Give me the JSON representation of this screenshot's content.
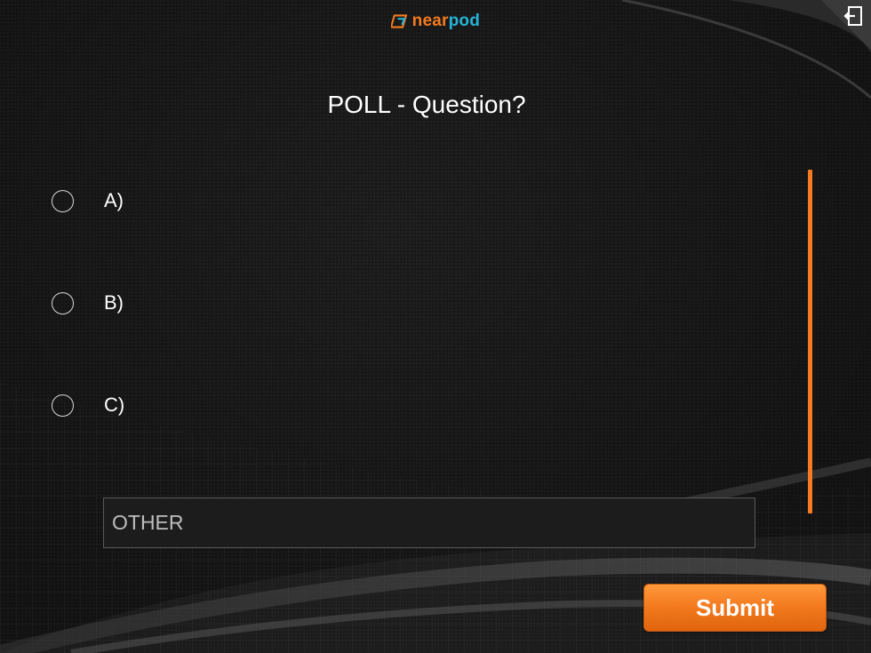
{
  "app": {
    "logo": {
      "near": "near",
      "pod": "pod"
    },
    "exit_icon": "exit-icon"
  },
  "poll": {
    "title": "POLL - Question?",
    "options": [
      {
        "label": "A)",
        "selected": false
      },
      {
        "label": "B)",
        "selected": false
      },
      {
        "label": "C)",
        "selected": false
      }
    ],
    "other": {
      "placeholder": "OTHER",
      "value": ""
    },
    "submit_label": "Submit"
  },
  "colors": {
    "accent": "#f47b20",
    "brand_blue": "#25b4d6",
    "background": "#1b1b1b"
  }
}
